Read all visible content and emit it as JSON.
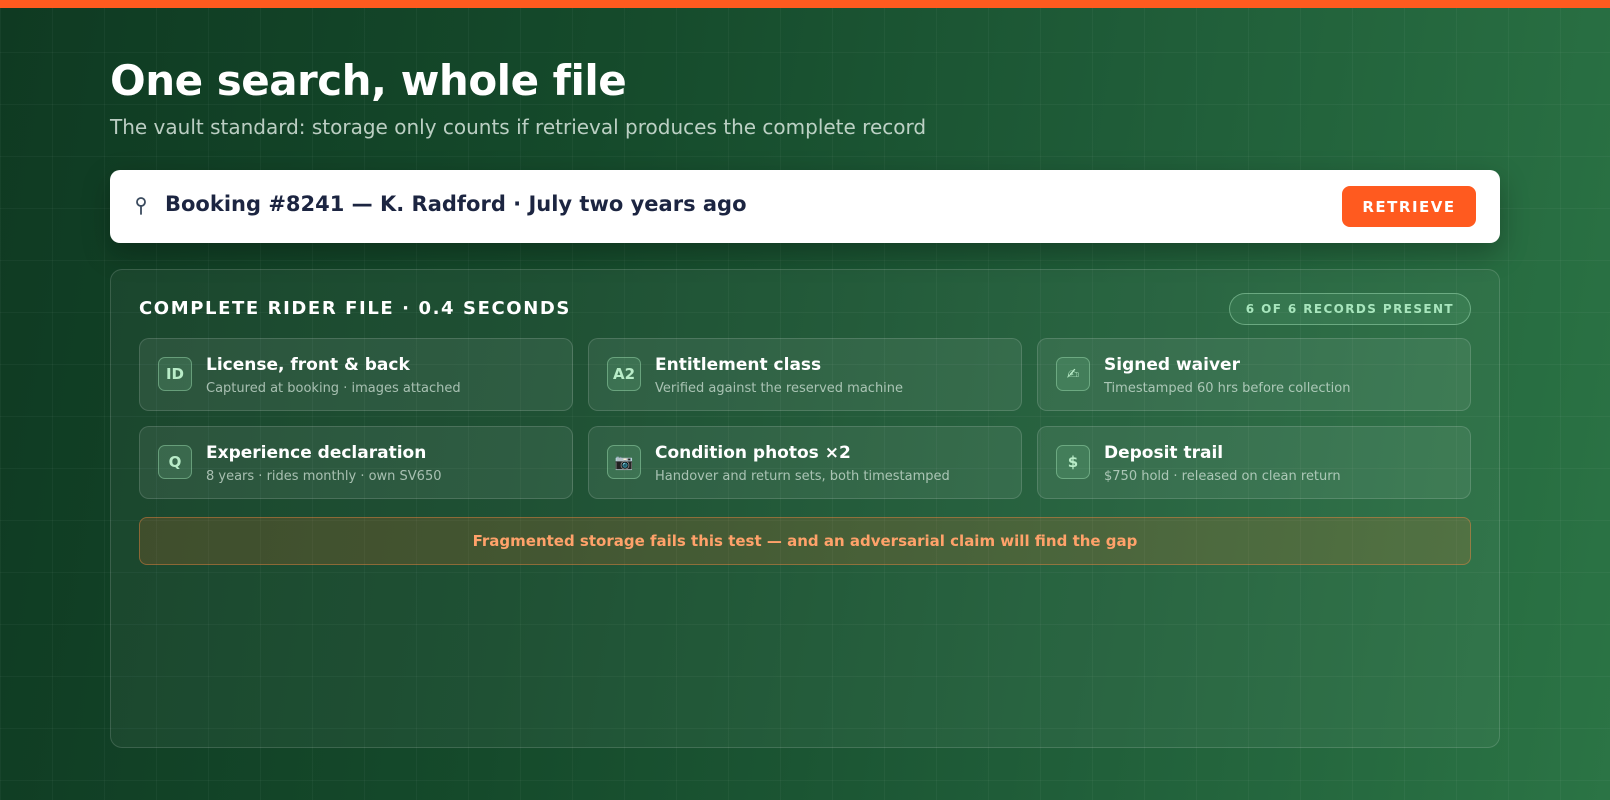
{
  "colors": {
    "accent": "#ff5a1f",
    "background": "#154a2b",
    "badge_text": "#a8e6bd",
    "warning_text": "#ffa26a",
    "search_text": "#1c2541"
  },
  "header": {
    "title": "One search, whole file",
    "subtitle": "The vault standard: storage only counts if retrieval produces the complete record"
  },
  "search": {
    "icon": "map-pin-icon",
    "value": "Booking #8241 — K. Radford · July two years ago",
    "button_label": "RETRIEVE"
  },
  "panel": {
    "heading": "COMPLETE RIDER FILE · 0.4 SECONDS",
    "badge": "6 OF 6 RECORDS PRESENT",
    "records": [
      {
        "icon": "ID",
        "icon_name": "id-card-icon",
        "title": "License, front & back",
        "description": "Captured at booking · images attached"
      },
      {
        "icon": "A2",
        "icon_name": "license-class-icon",
        "title": "Entitlement class",
        "description": "Verified against the reserved machine"
      },
      {
        "icon": "✍",
        "icon_name": "signature-icon",
        "title": "Signed waiver",
        "description": "Timestamped 60 hrs before collection"
      },
      {
        "icon": "Q",
        "icon_name": "questionnaire-icon",
        "title": "Experience declaration",
        "description": "8 years · rides monthly · own SV650"
      },
      {
        "icon": "📷",
        "icon_name": "camera-icon",
        "title": "Condition photos ×2",
        "description": "Handover and return sets, both timestamped"
      },
      {
        "icon": "$",
        "icon_name": "dollar-icon",
        "title": "Deposit trail",
        "description": "$750 hold · released on clean return"
      }
    ],
    "warning": "Fragmented storage fails this test — and an adversarial claim will find the gap"
  }
}
